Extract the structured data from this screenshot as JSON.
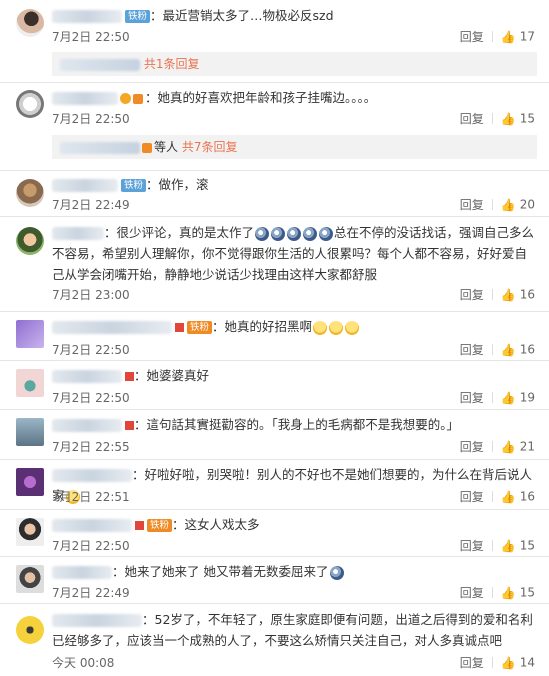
{
  "comments": [
    {
      "badge": "铁粉",
      "badge_color": "blue",
      "text": "最近营销太多了…物极必反szd",
      "time": "7月2日 22:50",
      "reply": "回复",
      "likes": "17",
      "thread": {
        "link": "共1条回复"
      }
    },
    {
      "text": "她真的好喜欢把年龄和孩子挂嘴边。。。。",
      "time": "7月2日 22:50",
      "reply": "回复",
      "likes": "15",
      "thread": {
        "prefix": "等人",
        "link": "共7条回复"
      }
    },
    {
      "badge": "铁粉",
      "badge_color": "blue",
      "text": "做作，滚",
      "time": "7月2日 22:49",
      "reply": "回复",
      "likes": "20"
    },
    {
      "text_a": "很少评论，真的是太作了",
      "text_b": "总在不停的没话找话，强调自己多么不容易，希望别人理解你，你不觉得跟你生活的人很累吗？每个人都不容易，好好爱自己从学会闭嘴开始，静静地少说话少找理由这样大家都舒服",
      "time": "7月2日 23:00",
      "reply": "回复",
      "likes": "16"
    },
    {
      "badge": "铁粉",
      "badge_color": "orange",
      "text": "她真的好招黑啊",
      "time": "7月2日 22:50",
      "reply": "回复",
      "likes": "16"
    },
    {
      "text": "她婆婆真好",
      "time": "7月2日 22:50",
      "reply": "回复",
      "likes": "19"
    },
    {
      "text": "這句話其實挺勸容的。「我身上的毛病都不是我想要的。」",
      "time": "7月2日 22:55",
      "reply": "回复",
      "likes": "21"
    },
    {
      "text": "好啦好啦，别哭啦！别人的不好也不是她们想要的，为什么在背后说人家",
      "time": "7月2日 22:51",
      "reply": "回复",
      "likes": "16"
    },
    {
      "badge": "铁粉",
      "badge_color": "orange",
      "text": "这女人戏太多",
      "time": "7月2日 22:50",
      "reply": "回复",
      "likes": "15"
    },
    {
      "text": "她来了她来了 她又带着无数委屈来了",
      "time": "7月2日 22:49",
      "reply": "回复",
      "likes": "15"
    },
    {
      "text": "52岁了，不年轻了，原生家庭即便有问题，出道之后得到的爱和名利已经够多了，应该当一个成熟的人了，不要这么矫情只关注自己，对人多真诚点吧",
      "time": "今天 00:08",
      "reply": "回复",
      "likes": "14"
    }
  ],
  "colors": {
    "link": "#eb7350",
    "badge_blue": "#5aa2d8",
    "badge_orange": "#f08a24"
  },
  "icons": {
    "like": "thumbs-up-icon"
  }
}
